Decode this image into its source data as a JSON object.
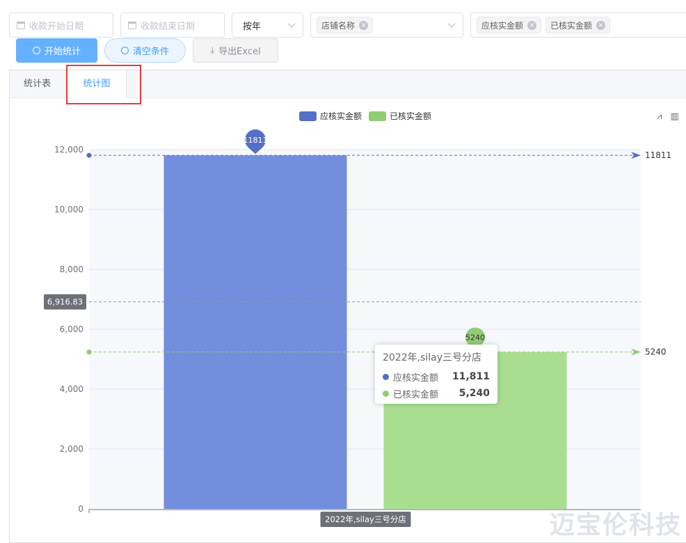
{
  "filters": {
    "start_date_placeholder": "收款开始日期",
    "end_date_placeholder": "收款结束日期",
    "period_value": "按年",
    "store_tag": "店铺名称",
    "metric_tags": [
      "应核实金额",
      "已核实金额"
    ]
  },
  "buttons": {
    "start": "开始统计",
    "clear": "清空条件",
    "export": "导出Excel"
  },
  "tabs": [
    "统计表",
    "统计图"
  ],
  "active_tab": "统计图",
  "colors": {
    "series1": "#5470c6",
    "series1_bar": "#728edc",
    "series2": "#91cc75",
    "series2_bar": "#a9de91",
    "highlight": "#e23b3b"
  },
  "chart_data": {
    "type": "bar",
    "categories": [
      "2022年,silay三号分店"
    ],
    "series": [
      {
        "name": "应核实金额",
        "values": [
          11811
        ]
      },
      {
        "name": "已核实金额",
        "values": [
          5240
        ]
      }
    ],
    "ylim": [
      0,
      12000
    ],
    "yticks": [
      "0",
      "2,000",
      "4,000",
      "6,000",
      "8,000",
      "10,000",
      "12,000"
    ],
    "average_line": {
      "value": 6916.83,
      "label": "6,916.83"
    },
    "markpoints": [
      "11811",
      "5240"
    ],
    "markline_labels": [
      "11811",
      "5240"
    ],
    "legend_position": "top-center",
    "grid": true
  },
  "tooltip": {
    "title": "2022年,silay三号分店",
    "rows": [
      {
        "name": "应核实金额",
        "value": "11,811"
      },
      {
        "name": "已核实金额",
        "value": "5,240"
      }
    ]
  },
  "watermark": "迈宝伦科技"
}
